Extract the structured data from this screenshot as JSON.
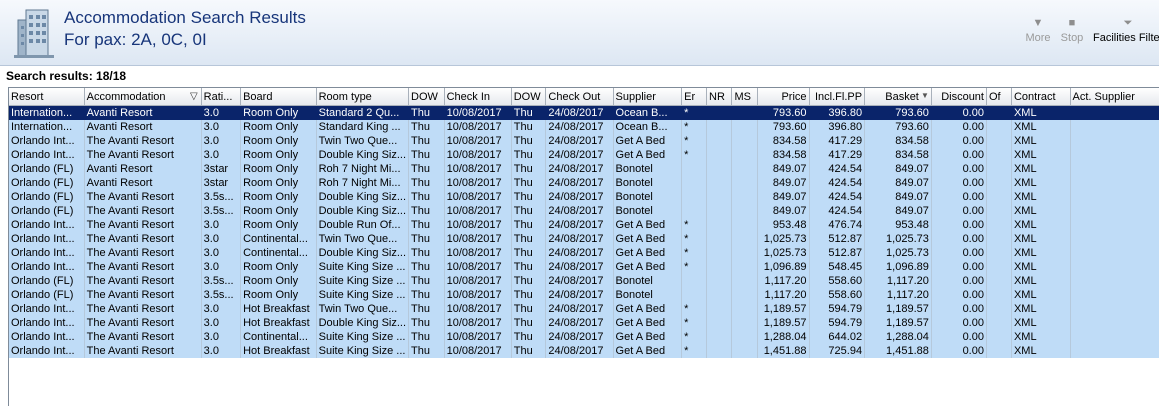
{
  "header": {
    "title_line1": "Accommodation Search Results",
    "title_line2": "For pax: 2A, 0C, 0I",
    "logo_icon": "building-icon"
  },
  "toolbar": {
    "more_label": "More",
    "stop_label": "Stop",
    "facilities_label": "Facilities Filter",
    "more_icon": "triangle-down-icon",
    "stop_icon": "stop-square-icon",
    "facilities_icon": "filter-funnel-icon"
  },
  "results": {
    "label": "Search results: 18/18"
  },
  "grid": {
    "columns": [
      "Resort",
      "Accommodation",
      "Rati...",
      "Board",
      "Room type",
      "DOW",
      "Check In",
      "DOW",
      "Check Out",
      "Supplier",
      "Er",
      "NR",
      "MS",
      "Price",
      "Incl.Fl.PP",
      "Basket",
      "Discount",
      "Of",
      "Contract",
      "Act. Supplier"
    ],
    "selected_row": 0,
    "rows": [
      [
        "Internation...",
        "Avanti Resort",
        "3.0",
        "Room Only",
        "Standard 2 Qu...",
        "Thu",
        "10/08/2017",
        "Thu",
        "24/08/2017",
        "Ocean B...",
        "*",
        "",
        "",
        "793.60",
        "396.80",
        "793.60",
        "0.00",
        "",
        "XML",
        ""
      ],
      [
        "Internation...",
        "Avanti Resort",
        "3.0",
        "Room Only",
        "Standard King ...",
        "Thu",
        "10/08/2017",
        "Thu",
        "24/08/2017",
        "Ocean B...",
        "*",
        "",
        "",
        "793.60",
        "396.80",
        "793.60",
        "0.00",
        "",
        "XML",
        ""
      ],
      [
        "Orlando Int...",
        "The Avanti Resort",
        "3.0",
        "Room Only",
        "Twin Two Que...",
        "Thu",
        "10/08/2017",
        "Thu",
        "24/08/2017",
        "Get A Bed",
        "*",
        "",
        "",
        "834.58",
        "417.29",
        "834.58",
        "0.00",
        "",
        "XML",
        ""
      ],
      [
        "Orlando Int...",
        "The Avanti Resort",
        "3.0",
        "Room Only",
        "Double King Siz...",
        "Thu",
        "10/08/2017",
        "Thu",
        "24/08/2017",
        "Get A Bed",
        "*",
        "",
        "",
        "834.58",
        "417.29",
        "834.58",
        "0.00",
        "",
        "XML",
        ""
      ],
      [
        "Orlando (FL)",
        "Avanti Resort",
        "3star",
        "Room Only",
        "Roh 7 Night Mi...",
        "Thu",
        "10/08/2017",
        "Thu",
        "24/08/2017",
        "Bonotel",
        "",
        "",
        "",
        "849.07",
        "424.54",
        "849.07",
        "0.00",
        "",
        "XML",
        ""
      ],
      [
        "Orlando (FL)",
        "Avanti Resort",
        "3star",
        "Room Only",
        "Roh 7 Night Mi...",
        "Thu",
        "10/08/2017",
        "Thu",
        "24/08/2017",
        "Bonotel",
        "",
        "",
        "",
        "849.07",
        "424.54",
        "849.07",
        "0.00",
        "",
        "XML",
        ""
      ],
      [
        "Orlando (FL)",
        "The Avanti Resort",
        "3.5s...",
        "Room Only",
        "Double King Siz...",
        "Thu",
        "10/08/2017",
        "Thu",
        "24/08/2017",
        "Bonotel",
        "",
        "",
        "",
        "849.07",
        "424.54",
        "849.07",
        "0.00",
        "",
        "XML",
        ""
      ],
      [
        "Orlando (FL)",
        "The Avanti Resort",
        "3.5s...",
        "Room Only",
        "Double King Siz...",
        "Thu",
        "10/08/2017",
        "Thu",
        "24/08/2017",
        "Bonotel",
        "",
        "",
        "",
        "849.07",
        "424.54",
        "849.07",
        "0.00",
        "",
        "XML",
        ""
      ],
      [
        "Orlando Int...",
        "The Avanti Resort",
        "3.0",
        "Room Only",
        "Double Run Of...",
        "Thu",
        "10/08/2017",
        "Thu",
        "24/08/2017",
        "Get A Bed",
        "*",
        "",
        "",
        "953.48",
        "476.74",
        "953.48",
        "0.00",
        "",
        "XML",
        ""
      ],
      [
        "Orlando Int...",
        "The Avanti Resort",
        "3.0",
        "Continental...",
        "Twin Two Que...",
        "Thu",
        "10/08/2017",
        "Thu",
        "24/08/2017",
        "Get A Bed",
        "*",
        "",
        "",
        "1,025.73",
        "512.87",
        "1,025.73",
        "0.00",
        "",
        "XML",
        ""
      ],
      [
        "Orlando Int...",
        "The Avanti Resort",
        "3.0",
        "Continental...",
        "Double King Siz...",
        "Thu",
        "10/08/2017",
        "Thu",
        "24/08/2017",
        "Get A Bed",
        "*",
        "",
        "",
        "1,025.73",
        "512.87",
        "1,025.73",
        "0.00",
        "",
        "XML",
        ""
      ],
      [
        "Orlando Int...",
        "The Avanti Resort",
        "3.0",
        "Room Only",
        "Suite King Size ...",
        "Thu",
        "10/08/2017",
        "Thu",
        "24/08/2017",
        "Get A Bed",
        "*",
        "",
        "",
        "1,096.89",
        "548.45",
        "1,096.89",
        "0.00",
        "",
        "XML",
        ""
      ],
      [
        "Orlando (FL)",
        "The Avanti Resort",
        "3.5s...",
        "Room Only",
        "Suite King Size ...",
        "Thu",
        "10/08/2017",
        "Thu",
        "24/08/2017",
        "Bonotel",
        "",
        "",
        "",
        "1,117.20",
        "558.60",
        "1,117.20",
        "0.00",
        "",
        "XML",
        ""
      ],
      [
        "Orlando (FL)",
        "The Avanti Resort",
        "3.5s...",
        "Room Only",
        "Suite King Size ...",
        "Thu",
        "10/08/2017",
        "Thu",
        "24/08/2017",
        "Bonotel",
        "",
        "",
        "",
        "1,117.20",
        "558.60",
        "1,117.20",
        "0.00",
        "",
        "XML",
        ""
      ],
      [
        "Orlando Int...",
        "The Avanti Resort",
        "3.0",
        "Hot Breakfast",
        "Twin Two Que...",
        "Thu",
        "10/08/2017",
        "Thu",
        "24/08/2017",
        "Get A Bed",
        "*",
        "",
        "",
        "1,189.57",
        "594.79",
        "1,189.57",
        "0.00",
        "",
        "XML",
        ""
      ],
      [
        "Orlando Int...",
        "The Avanti Resort",
        "3.0",
        "Hot Breakfast",
        "Double King Siz...",
        "Thu",
        "10/08/2017",
        "Thu",
        "24/08/2017",
        "Get A Bed",
        "*",
        "",
        "",
        "1,189.57",
        "594.79",
        "1,189.57",
        "0.00",
        "",
        "XML",
        ""
      ],
      [
        "Orlando Int...",
        "The Avanti Resort",
        "3.0",
        "Continental...",
        "Suite King Size ...",
        "Thu",
        "10/08/2017",
        "Thu",
        "24/08/2017",
        "Get A Bed",
        "*",
        "",
        "",
        "1,288.04",
        "644.02",
        "1,288.04",
        "0.00",
        "",
        "XML",
        ""
      ],
      [
        "Orlando Int...",
        "The Avanti Resort",
        "3.0",
        "Hot Breakfast",
        "Suite King Size ...",
        "Thu",
        "10/08/2017",
        "Thu",
        "24/08/2017",
        "Get A Bed",
        "*",
        "",
        "",
        "1,451.88",
        "725.94",
        "1,451.88",
        "0.00",
        "",
        "XML",
        ""
      ]
    ]
  }
}
